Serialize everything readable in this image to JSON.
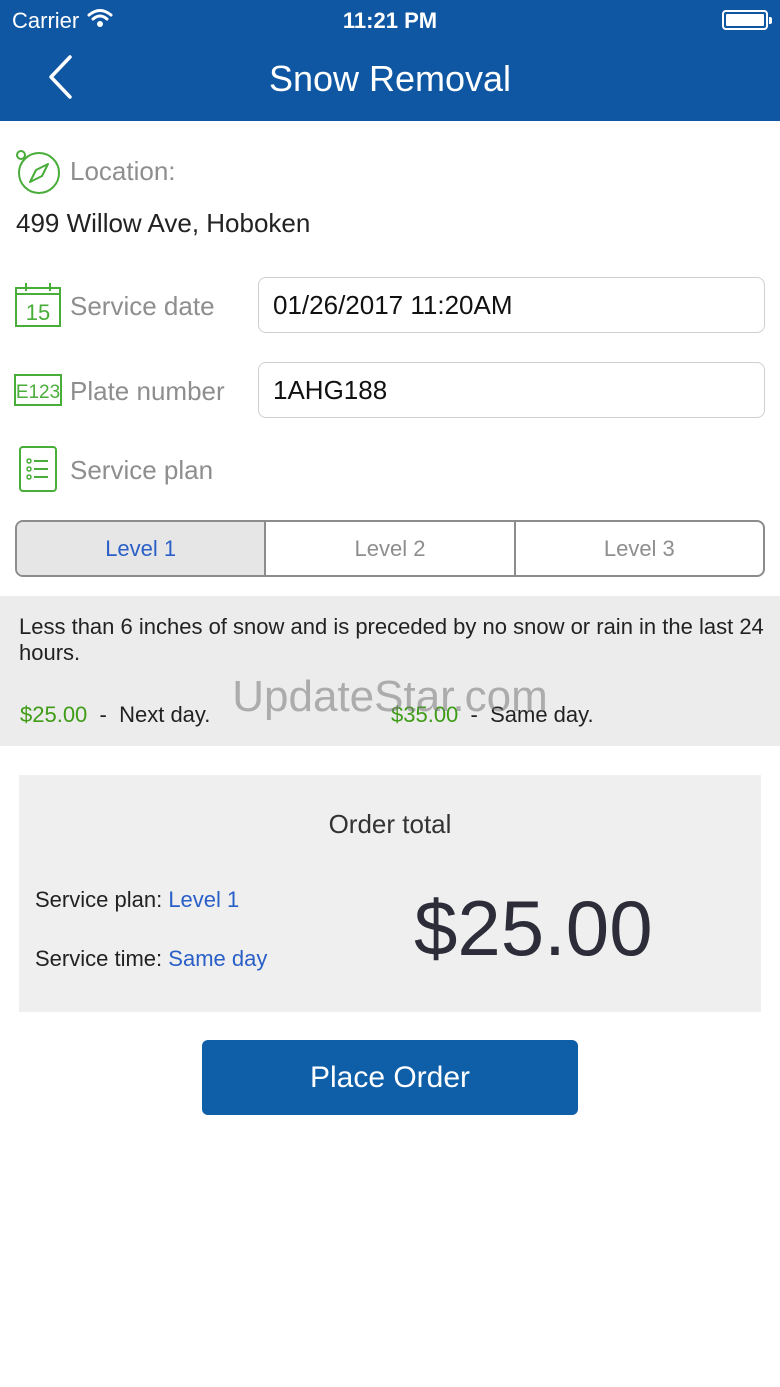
{
  "status_bar": {
    "carrier": "Carrier",
    "time": "11:21 PM"
  },
  "nav": {
    "title": "Snow Removal"
  },
  "location": {
    "label": "Location:",
    "address": "499 Willow Ave, Hoboken"
  },
  "service_date": {
    "icon_text": "15",
    "label": "Service date",
    "value": "01/26/2017 11:20AM"
  },
  "plate": {
    "icon_text": "E123",
    "label": "Plate number",
    "value": "1AHG188"
  },
  "service_plan": {
    "label": "Service plan",
    "levels": [
      "Level 1",
      "Level 2",
      "Level 3"
    ],
    "selected": "Level 1"
  },
  "plan_details": {
    "description": "Less than 6 inches of snow and is preceded by no snow or rain in the last 24 hours.",
    "options": [
      {
        "price": "$25.00",
        "separator": "-",
        "timing": "Next day."
      },
      {
        "price": "$35.00",
        "separator": "-",
        "timing": "Same day."
      }
    ]
  },
  "watermark": "UpdateStar.com",
  "order": {
    "title": "Order total",
    "plan_label": "Service plan:",
    "plan_value": "Level 1",
    "time_label": "Service time:",
    "time_value": "Same day",
    "total": "$25.00"
  },
  "actions": {
    "place_order": "Place Order"
  },
  "colors": {
    "header": "#0f57a2",
    "accent_green": "#3f9c17",
    "link_blue": "#2a5fc7",
    "button": "#0f5ea8"
  }
}
